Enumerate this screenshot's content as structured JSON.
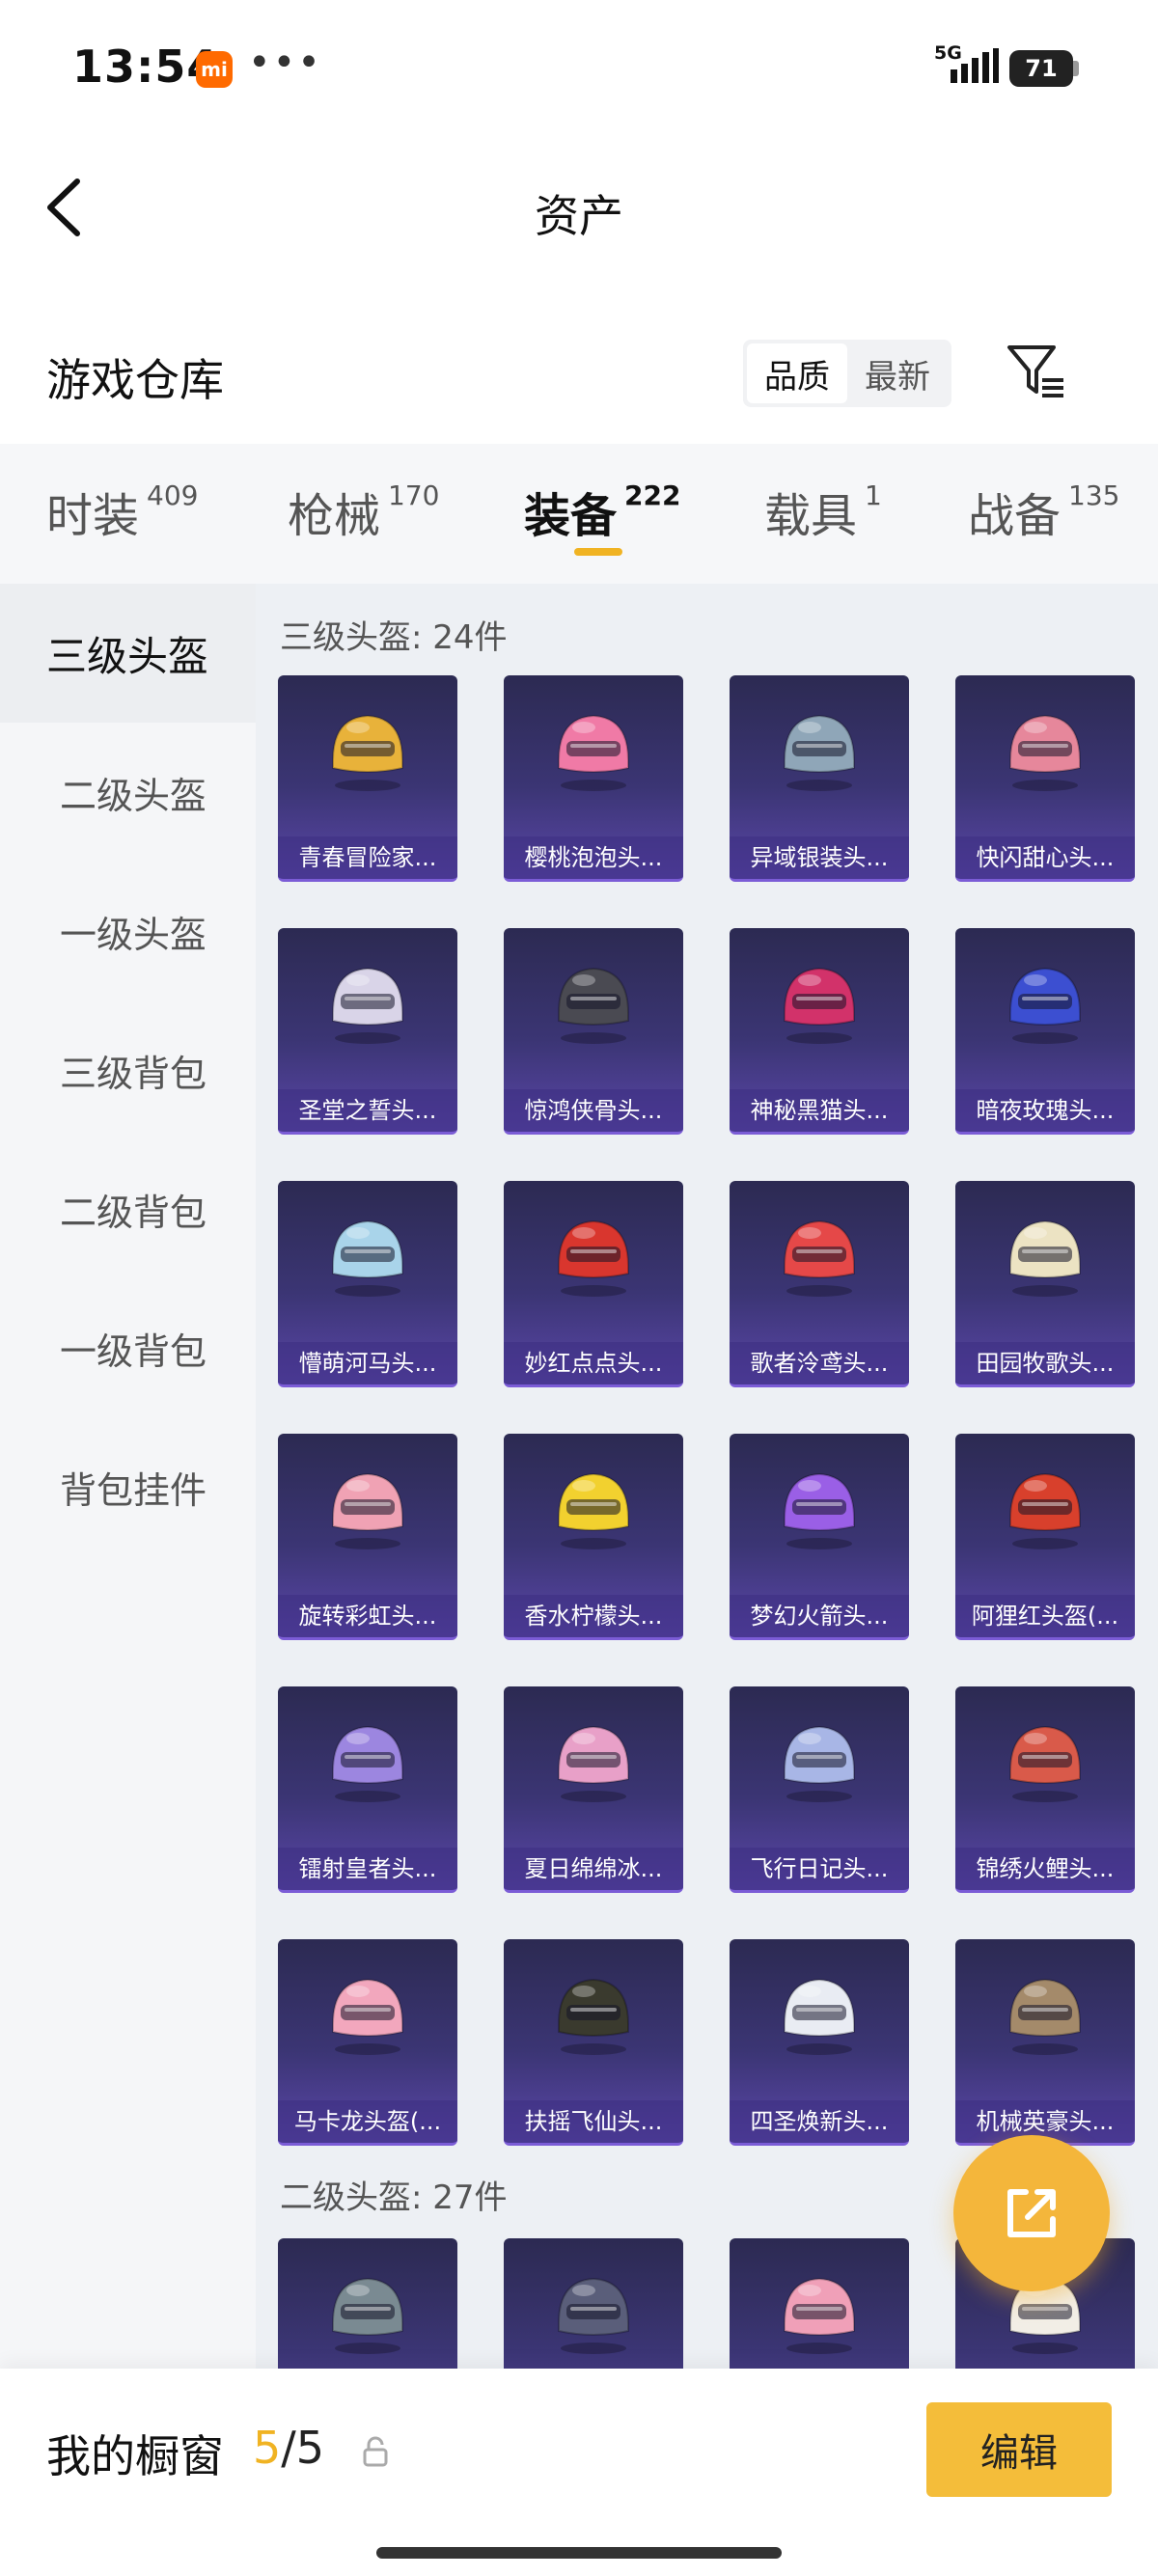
{
  "status_bar": {
    "time": "13:54",
    "network": "5G",
    "battery": "71",
    "mi_badge": "mi",
    "dots": "•••"
  },
  "nav": {
    "title": "资产"
  },
  "header": {
    "section_title": "游戏仓库",
    "sort_options": [
      "品质",
      "最新"
    ],
    "sort_active": "品质"
  },
  "tabs": [
    {
      "label": "时装",
      "count": "409"
    },
    {
      "label": "枪械",
      "count": "170"
    },
    {
      "label": "装备",
      "count": "222"
    },
    {
      "label": "载具",
      "count": "1"
    },
    {
      "label": "战备",
      "count": "135"
    }
  ],
  "sidebar": {
    "items": [
      "三级头盔",
      "二级头盔",
      "一级头盔",
      "三级背包",
      "二级背包",
      "一级背包",
      "背包挂件"
    ]
  },
  "groups": [
    {
      "label": "三级头盔: 24件",
      "items": [
        {
          "name": "青春冒险家...",
          "color": "#e8b23a"
        },
        {
          "name": "樱桃泡泡头...",
          "color": "#f07aa6"
        },
        {
          "name": "异域银装头...",
          "color": "#8fa6b8"
        },
        {
          "name": "快闪甜心头...",
          "color": "#e6879b"
        },
        {
          "name": "圣堂之誓头...",
          "color": "#d9d4e8"
        },
        {
          "name": "惊鸿侠骨头...",
          "color": "#4a4a52"
        },
        {
          "name": "神秘黑猫头...",
          "color": "#d2326a"
        },
        {
          "name": "暗夜玫瑰头...",
          "color": "#3c4fd1"
        },
        {
          "name": "懵萌河马头...",
          "color": "#a9d4ea"
        },
        {
          "name": "妙红点点头...",
          "color": "#d9362e"
        },
        {
          "name": "歌者泠鸢头...",
          "color": "#e54848"
        },
        {
          "name": "田园牧歌头...",
          "color": "#ece3c3"
        },
        {
          "name": "旋转彩虹头...",
          "color": "#f0a2b4"
        },
        {
          "name": "香水柠檬头...",
          "color": "#f2d12f"
        },
        {
          "name": "梦幻火箭头...",
          "color": "#9a5fe6"
        },
        {
          "name": "阿狸红头盔(...",
          "color": "#d8402c"
        },
        {
          "name": "镭射皇者头...",
          "color": "#9c86e0"
        },
        {
          "name": "夏日绵绵冰...",
          "color": "#e8a0c8"
        },
        {
          "name": "飞行日记头...",
          "color": "#a8b6e6"
        },
        {
          "name": "锦绣火鲤头...",
          "color": "#d95a4a"
        },
        {
          "name": "马卡龙头盔(...",
          "color": "#f2a7bd"
        },
        {
          "name": "扶摇飞仙头...",
          "color": "#3a3a2e"
        },
        {
          "name": "四圣焕新头...",
          "color": "#e9ecf3"
        },
        {
          "name": "机械英豪头...",
          "color": "#a48a6a"
        }
      ]
    },
    {
      "label": "二级头盔: 27件",
      "items": [
        {
          "name": "",
          "color": "#7a8a92"
        },
        {
          "name": "",
          "color": "#5a5e7a"
        },
        {
          "name": "",
          "color": "#f0a0b8"
        },
        {
          "name": "",
          "color": "#f2eee6"
        }
      ]
    }
  ],
  "bottom": {
    "showcase_label": "我的橱窗",
    "current": "5",
    "total": "/5",
    "edit_label": "编辑"
  },
  "colors": {
    "accent": "#f0b323",
    "card_bg": "#3b3574"
  }
}
